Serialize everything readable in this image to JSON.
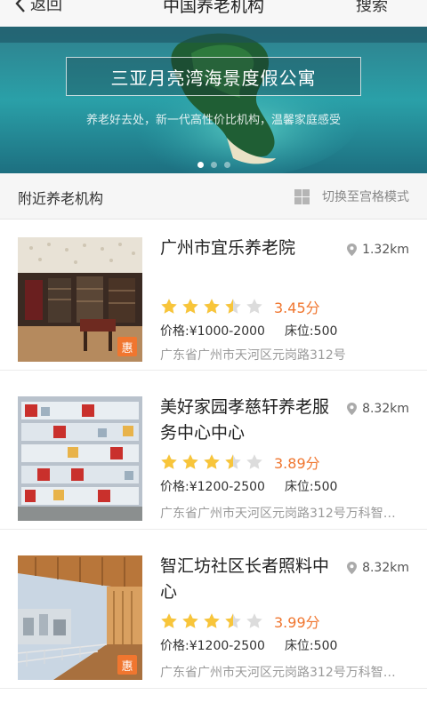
{
  "header": {
    "back_label": "返回",
    "title": "中国养老机构",
    "search_label": "搜索"
  },
  "banner": {
    "caption": "三亚月亮湾海景度假公寓",
    "subtitle": "养老好去处，新一代高性价比机构，温馨家庭感受",
    "dots": 3,
    "active_dot": 1
  },
  "section": {
    "title": "附近养老机构",
    "switch_label": "切换至宫格模式",
    "grid_icon": "grid-icon"
  },
  "items": [
    {
      "name": "广州市宜乐养老院",
      "distance": "1.32km",
      "rating": 3.5,
      "score": "3.45分",
      "price_label": "价格:",
      "price": "¥1000-2000",
      "bed_label": "床位:",
      "beds": "500",
      "address": "广东省广州市天河区元岗路312号",
      "badge": "惠",
      "image": "library-interior"
    },
    {
      "name": "美好家园孝慈轩养老服务中心中心",
      "distance": "8.32km",
      "rating": 3.5,
      "score": "3.89分",
      "price_label": "价格:",
      "price": "¥1200-2500",
      "bed_label": "床位:",
      "beds": "500",
      "address": "广东省广州市天河区元岗路312号万科智…",
      "badge": "",
      "image": "apartment-building"
    },
    {
      "name": "智汇坊社区长者照料中心",
      "distance": "8.32km",
      "rating": 3.5,
      "score": "3.99分",
      "price_label": "价格:",
      "price": "¥1200-2500",
      "bed_label": "床位:",
      "beds": "500",
      "address": "广东省广州市天河区元岗路312号万科智…",
      "badge": "惠",
      "image": "wooden-balcony"
    }
  ],
  "colors": {
    "accent": "#f0762f",
    "star": "#f8c53a",
    "star_empty": "#dcdcdc"
  }
}
